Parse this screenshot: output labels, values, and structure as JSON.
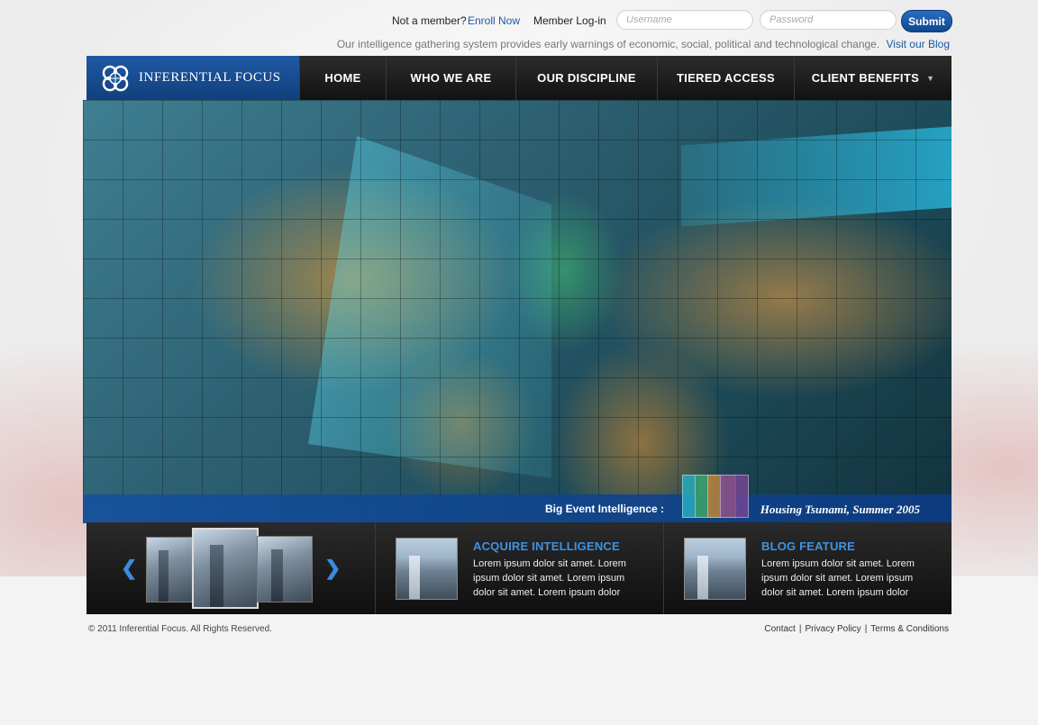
{
  "header": {
    "not_member": "Not a member?",
    "enroll": "Enroll Now",
    "login_label": "Member Log-in",
    "username_placeholder": "Username",
    "password_placeholder": "Password",
    "submit": "Submit",
    "tagline": "Our intelligence gathering system provides early warnings of economic, social, political and technological change.",
    "blog_link": "Visit our Blog"
  },
  "brand": {
    "name": "INFERENTIAL FOCUS"
  },
  "nav": {
    "items": [
      "HOME",
      "WHO WE ARE",
      "OUR DISCIPLINE",
      "TIERED ACCESS",
      "CLIENT BENEFITS"
    ]
  },
  "hero": {
    "label": "Big Event Intelligence :",
    "event": "Housing Tsunami, Summer 2005"
  },
  "features": [
    {
      "title": "ACQUIRE INTELLIGENCE",
      "body": "Lorem ipsum dolor sit amet. Lorem ipsum dolor sit amet. Lorem ipsum dolor sit amet. Lorem ipsum dolor"
    },
    {
      "title": "BLOG FEATURE",
      "body": "Lorem ipsum dolor sit amet. Lorem ipsum dolor sit amet. Lorem ipsum dolor sit amet. Lorem ipsum dolor"
    }
  ],
  "footer": {
    "copyright": "© 2011 Inferential Focus. All Rights Reserved.",
    "links": [
      "Contact",
      "Privacy Policy",
      "Terms & Conditions"
    ]
  },
  "colors": {
    "brand_blue": "#1f5aa5",
    "link_blue": "#1a5a9c",
    "feature_title": "#3e93e4"
  }
}
